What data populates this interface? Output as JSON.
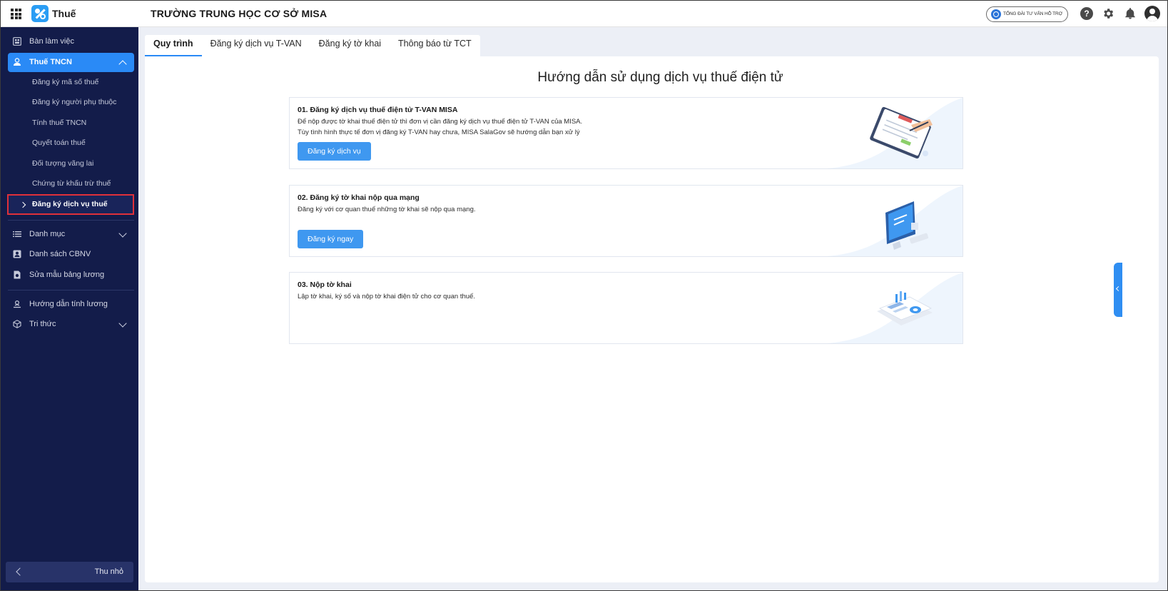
{
  "app": {
    "name": "Thuế",
    "org_title": "TRƯỜNG TRUNG HỌC CƠ SỞ MISA",
    "support_label": "TỔNG ĐÀI TƯ VẤN HỖ TRỢ"
  },
  "sidebar": {
    "items": [
      {
        "label": "Bàn làm việc",
        "icon": "dashboard-icon"
      },
      {
        "label": "Thuế TNCN",
        "icon": "tax-icon",
        "active": true
      },
      {
        "label": "Danh mục",
        "icon": "list-icon"
      },
      {
        "label": "Danh sách CBNV",
        "icon": "staff-icon"
      },
      {
        "label": "Sửa mẫu bảng lương",
        "icon": "template-icon"
      },
      {
        "label": "Hướng dẫn tính lương",
        "icon": "guide-icon"
      },
      {
        "label": "Tri thức",
        "icon": "knowledge-icon"
      }
    ],
    "sub_items": [
      {
        "label": "Đăng ký mã số thuế"
      },
      {
        "label": "Đăng ký người phụ thuộc"
      },
      {
        "label": "Tính thuế TNCN"
      },
      {
        "label": "Quyết toán thuế"
      },
      {
        "label": "Đối tượng vãng lai"
      },
      {
        "label": "Chứng từ khấu trừ thuế"
      },
      {
        "label": "Đăng ký dịch vụ thuế",
        "selected": true
      }
    ],
    "collapse_label": "Thu nhỏ"
  },
  "tabs": [
    {
      "label": "Quy trình",
      "active": true
    },
    {
      "label": "Đăng ký dịch vụ T-VAN"
    },
    {
      "label": "Đăng ký tờ khai"
    },
    {
      "label": "Thông báo từ TCT"
    }
  ],
  "main": {
    "title": "Hướng dẫn sử dụng dịch vụ thuế điện tử",
    "steps": [
      {
        "title": "01. Đăng ký dịch vụ thuế điện tử T-VAN MISA",
        "desc_line1": "Để nộp được tờ khai thuế điện tử thì đơn vị cần đăng ký dịch vụ thuế điện tử T-VAN của MISA.",
        "desc_line2": "Tùy tình hình thực tế đơn vị đăng ký T-VAN hay chưa, MISA SalaGov sẽ hướng dẫn bạn xử lý",
        "button": "Đăng ký dịch vụ",
        "illustration": "tax-document-illustration"
      },
      {
        "title": "02. Đăng ký tờ khai nộp qua mạng",
        "desc_line1": "Đăng ký với cơ quan thuế những tờ khai sẽ nộp qua mạng.",
        "button": "Đăng ký ngay",
        "illustration": "computer-illustration"
      },
      {
        "title": "03. Nộp tờ khai",
        "desc_line1": "Lập tờ khai, ký số và nộp tờ khai điện tử cho cơ quan thuế.",
        "illustration": "report-illustration"
      }
    ]
  },
  "colors": {
    "sidebar_bg": "#131c4a",
    "accent": "#2a8af6",
    "button": "#3f98f0",
    "highlight_border": "#e0303a",
    "main_bg": "#eceff6"
  }
}
